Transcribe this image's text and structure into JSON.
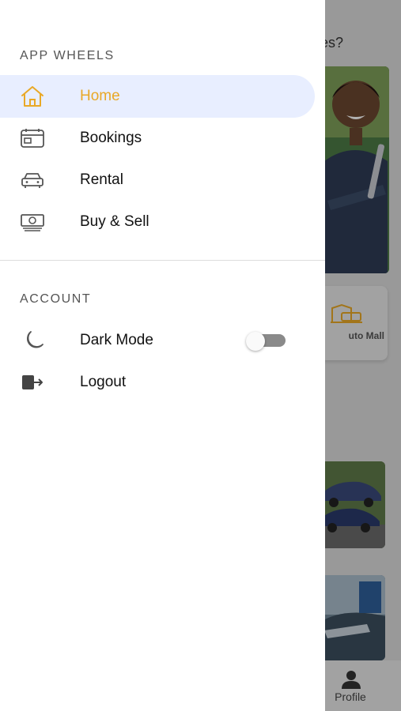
{
  "background": {
    "question_fragment": "ues?",
    "card_label": "uto Mall",
    "tab_profile": "Profile"
  },
  "drawer": {
    "brand_title": "APP WHEELS",
    "nav_items": [
      {
        "label": "Home",
        "icon": "home-icon",
        "active": true
      },
      {
        "label": "Bookings",
        "icon": "calendar-icon",
        "active": false
      },
      {
        "label": "Rental",
        "icon": "car-icon",
        "active": false
      },
      {
        "label": "Buy & Sell",
        "icon": "money-icon",
        "active": false
      }
    ],
    "account_title": "ACCOUNT",
    "account_items": [
      {
        "label": "Dark Mode",
        "icon": "moon-icon",
        "toggle": false
      },
      {
        "label": "Logout",
        "icon": "logout-icon"
      }
    ]
  },
  "colors": {
    "accent": "#e9a826",
    "active_bg": "#e8eeff"
  }
}
